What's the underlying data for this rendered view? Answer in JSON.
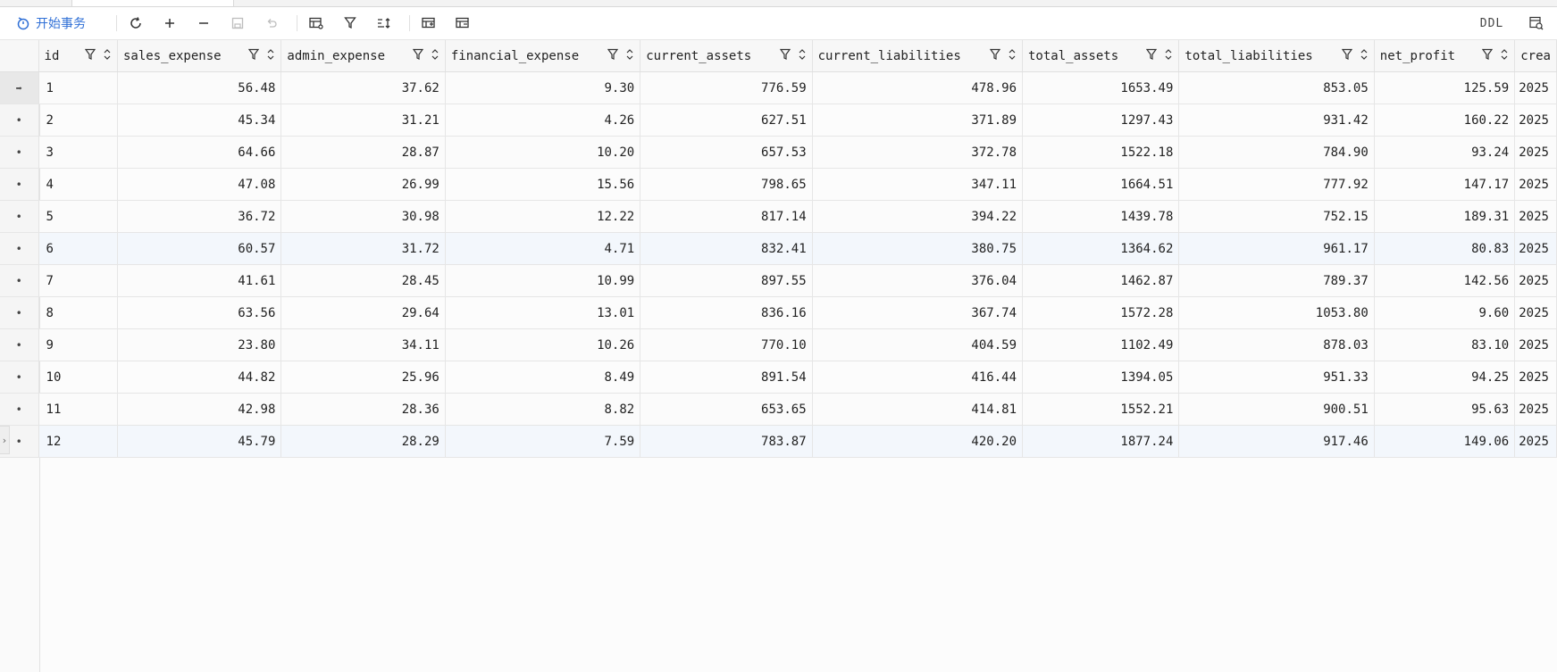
{
  "toolbar": {
    "begin_transaction": "开始事务",
    "ddl": "DDL"
  },
  "columns": [
    {
      "key": "id",
      "label": "id",
      "width": 89,
      "align": "left"
    },
    {
      "key": "sales_expense",
      "label": "sales_expense",
      "width": 184,
      "align": "right"
    },
    {
      "key": "admin_expense",
      "label": "admin_expense",
      "width": 184,
      "align": "right"
    },
    {
      "key": "financial_expense",
      "label": "financial_expense",
      "width": 219,
      "align": "right"
    },
    {
      "key": "current_assets",
      "label": "current_assets",
      "width": 193,
      "align": "right"
    },
    {
      "key": "current_liabilities",
      "label": "current_liabilities",
      "width": 236,
      "align": "right"
    },
    {
      "key": "total_assets",
      "label": "total_assets",
      "width": 176,
      "align": "right"
    },
    {
      "key": "total_liabilities",
      "label": "total_liabilities",
      "width": 219,
      "align": "right"
    },
    {
      "key": "net_profit",
      "label": "net_profit",
      "width": 158,
      "align": "right"
    },
    {
      "key": "created",
      "label": "crea",
      "width": 40,
      "align": "left"
    }
  ],
  "rows": [
    {
      "marker": "➡",
      "cells": [
        "1",
        "56.48",
        "37.62",
        "9.30",
        "776.59",
        "478.96",
        "1653.49",
        "853.05",
        "125.59",
        "2025"
      ]
    },
    {
      "marker": "•",
      "cells": [
        "2",
        "45.34",
        "31.21",
        "4.26",
        "627.51",
        "371.89",
        "1297.43",
        "931.42",
        "160.22",
        "2025"
      ]
    },
    {
      "marker": "•",
      "cells": [
        "3",
        "64.66",
        "28.87",
        "10.20",
        "657.53",
        "372.78",
        "1522.18",
        "784.90",
        "93.24",
        "2025"
      ]
    },
    {
      "marker": "•",
      "cells": [
        "4",
        "47.08",
        "26.99",
        "15.56",
        "798.65",
        "347.11",
        "1664.51",
        "777.92",
        "147.17",
        "2025"
      ]
    },
    {
      "marker": "•",
      "cells": [
        "5",
        "36.72",
        "30.98",
        "12.22",
        "817.14",
        "394.22",
        "1439.78",
        "752.15",
        "189.31",
        "2025"
      ]
    },
    {
      "marker": "•",
      "cells": [
        "6",
        "60.57",
        "31.72",
        "4.71",
        "832.41",
        "380.75",
        "1364.62",
        "961.17",
        "80.83",
        "2025"
      ]
    },
    {
      "marker": "•",
      "cells": [
        "7",
        "41.61",
        "28.45",
        "10.99",
        "897.55",
        "376.04",
        "1462.87",
        "789.37",
        "142.56",
        "2025"
      ]
    },
    {
      "marker": "•",
      "cells": [
        "8",
        "63.56",
        "29.64",
        "13.01",
        "836.16",
        "367.74",
        "1572.28",
        "1053.80",
        "9.60",
        "2025"
      ]
    },
    {
      "marker": "•",
      "cells": [
        "9",
        "23.80",
        "34.11",
        "10.26",
        "770.10",
        "404.59",
        "1102.49",
        "878.03",
        "83.10",
        "2025"
      ]
    },
    {
      "marker": "•",
      "cells": [
        "10",
        "44.82",
        "25.96",
        "8.49",
        "891.54",
        "416.44",
        "1394.05",
        "951.33",
        "94.25",
        "2025"
      ]
    },
    {
      "marker": "•",
      "cells": [
        "11",
        "42.98",
        "28.36",
        "8.82",
        "653.65",
        "414.81",
        "1552.21",
        "900.51",
        "95.63",
        "2025"
      ]
    },
    {
      "marker": "•",
      "cells": [
        "12",
        "45.79",
        "28.29",
        "7.59",
        "783.87",
        "420.20",
        "1877.24",
        "917.46",
        "149.06",
        "2025"
      ]
    }
  ],
  "highlighted_rows": [
    5,
    11
  ],
  "colors": {
    "accent": "#2f6fd6",
    "icon": "#333333",
    "disabled": "#bdbdbd"
  }
}
